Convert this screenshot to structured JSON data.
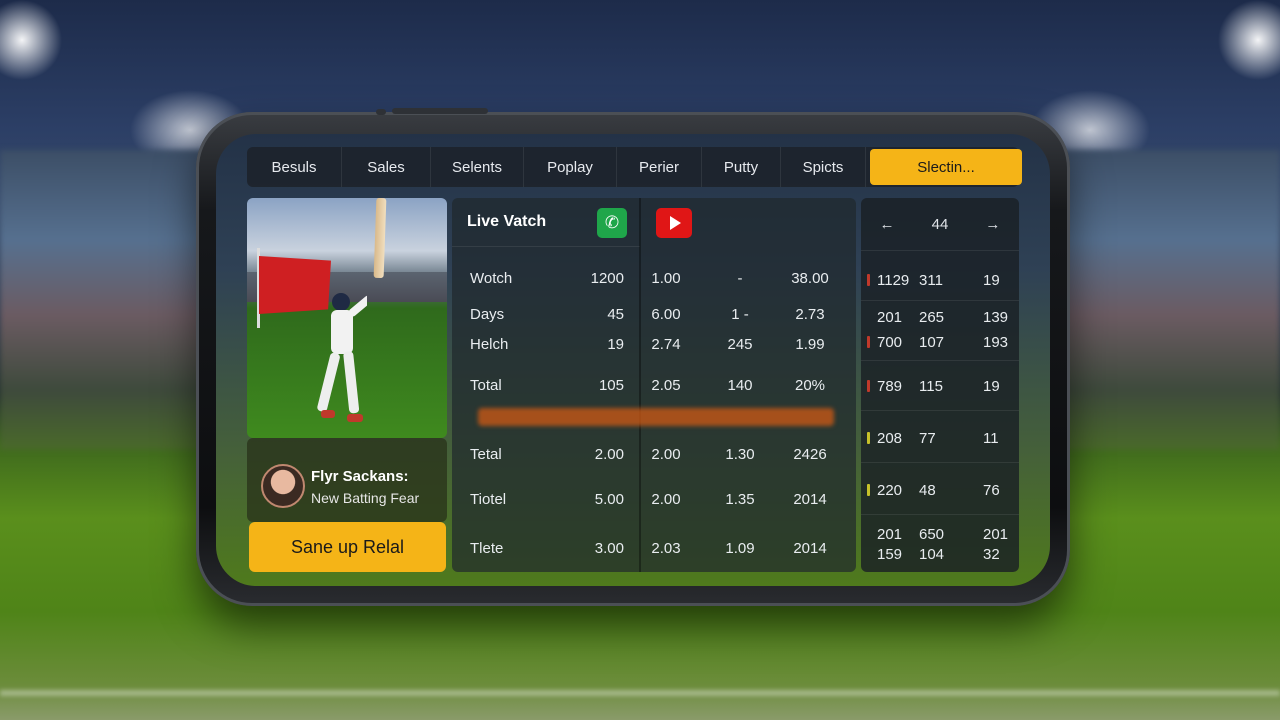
{
  "tabs": [
    "Besuls",
    "Sales",
    "Selents",
    "Poplay",
    "Perier",
    "Putty",
    "Spicts",
    "Slectin..."
  ],
  "active_tab_index": 7,
  "profile": {
    "name": "Flyr Sackans:",
    "subtitle": "New Batting Fear"
  },
  "cta_label": "Sane up Relal",
  "live": {
    "title": "Live Vatch",
    "phone_icon": "phone-icon",
    "video_icon": "youtube-icon"
  },
  "table_rows": [
    {
      "label": "Wotch",
      "c1": "1200",
      "c2": "1.00",
      "c3": "-",
      "c4": "38.00"
    },
    {
      "label": "Days",
      "c1": "45",
      "c2": "6.00",
      "c3": "1 -",
      "c4": "2.73"
    },
    {
      "label": "Helch",
      "c1": "19",
      "c2": "2.74",
      "c3": "245",
      "c4": "1.99"
    },
    {
      "label": "Total",
      "c1": "105",
      "c2": "2.05",
      "c3": "140",
      "c4": "20%"
    },
    {
      "label": "Tetal",
      "c1": "2.00",
      "c2": "2.00",
      "c3": "1.30",
      "c4": "2426"
    },
    {
      "label": "Tiotel",
      "c1": "5.00",
      "c2": "2.00",
      "c3": "1.35",
      "c4": "2014"
    },
    {
      "label": "Tlete",
      "c1": "3.00",
      "c2": "2.03",
      "c3": "1.09",
      "c4": "2014"
    }
  ],
  "side": {
    "nav_value": "44",
    "rows": [
      {
        "a": "1129",
        "b": "311",
        "c": "19",
        "mark": "#c0392b"
      },
      {
        "a": "201",
        "b": "265",
        "c": "139",
        "mark": ""
      },
      {
        "a": "700",
        "b": "107",
        "c": "193",
        "mark": "#c0392b"
      },
      {
        "a": "789",
        "b": "115",
        "c": "19",
        "mark": "#c0392b"
      },
      {
        "a": "208",
        "b": "77",
        "c": "11",
        "mark": "#c7c12a"
      },
      {
        "a": "220",
        "b": "48",
        "c": "76",
        "mark": "#c7c12a"
      },
      {
        "a": "201",
        "b": "650",
        "c": "201",
        "mark": ""
      },
      {
        "a": "159",
        "b": "104",
        "c": "32",
        "mark": ""
      }
    ]
  },
  "colors": {
    "accent": "#f5b417",
    "phone_green": "#1fa64a",
    "youtube_red": "#e01616"
  }
}
